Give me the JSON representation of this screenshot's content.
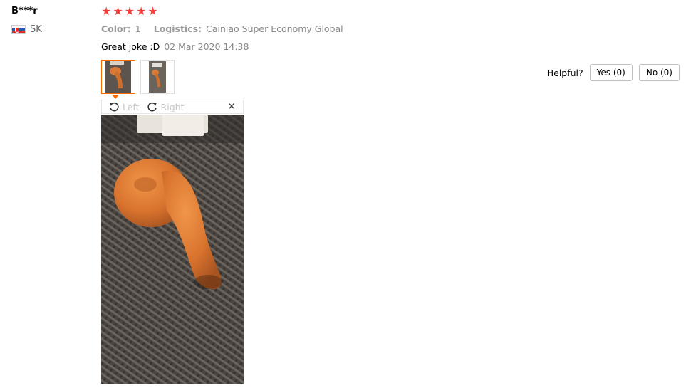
{
  "reviewer": {
    "name": "B***r",
    "country_code": "SK",
    "flag_colors": {
      "white": "#ffffff",
      "blue": "#2a57b4",
      "red": "#e02a2a"
    }
  },
  "rating": {
    "stars": 5,
    "max": 5,
    "color": "#f0413c"
  },
  "order_meta": {
    "color_label": "Color:",
    "color_value": "1",
    "logistics_label": "Logistics:",
    "logistics_value": "Cainiao Super Economy Global"
  },
  "review": {
    "text": "Great joke :D",
    "date": "02 Mar 2020 14:38"
  },
  "photos": {
    "thumbnails": [
      {
        "label": "photo-1",
        "selected": true
      },
      {
        "label": "photo-2",
        "selected": false
      }
    ],
    "accent_color": "#ff6a00"
  },
  "viewer_toolbar": {
    "rotate_left_label": "Left",
    "rotate_right_label": "Right",
    "close_icon": "close-icon"
  },
  "helpful": {
    "label": "Helpful?",
    "yes_label": "Yes (0)",
    "no_label": "No (0)"
  }
}
